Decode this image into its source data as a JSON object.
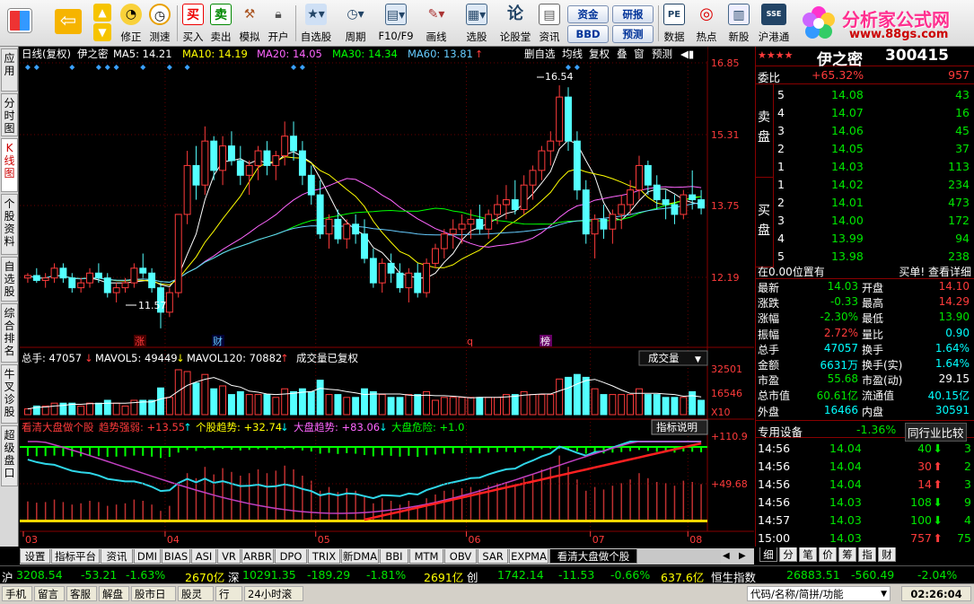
{
  "toolbar": {
    "buttons": [
      "修正",
      "测速",
      "买入",
      "卖出",
      "模拟",
      "开户",
      "自选股",
      "周期",
      "F10/F9",
      "画线",
      "选股",
      "论股堂",
      "资讯",
      "数据",
      "热点",
      "新股",
      "沪港通"
    ],
    "pills": [
      "资金",
      "研报",
      "BBD",
      "预测"
    ],
    "logo_title": "分析家公式网",
    "logo_url": "www.88gs.com"
  },
  "left_tabs": [
    "应用",
    "分时图",
    "K线图",
    "个股资料",
    "自选股",
    "综合排名",
    "牛叉诊股",
    "超级盘口"
  ],
  "chart_header": {
    "period": "日线(复权)",
    "stock": "伊之密",
    "ma5": "MA5: 14.21",
    "ma10": "MA10: 14.19",
    "ma20": "MA20: 14.05",
    "ma30": "MA30: 14.34",
    "ma60": "MA60: 13.81",
    "buttons": [
      "删自选",
      "均线",
      "复权",
      "叠",
      "窗",
      "预测"
    ]
  },
  "price_axis": [
    "16.85",
    "15.31",
    "13.75",
    "12.19"
  ],
  "price_marks": {
    "high": "16.54",
    "low": "11.57"
  },
  "event_marks": [
    "涨",
    "财",
    "q",
    "榜"
  ],
  "volume_header": {
    "total": "总手: 47057",
    "mavol5": "MAVOL5: 49449",
    "mavol120": "MAVOL120: 70882",
    "note": "成交量已复权",
    "select": "成交量"
  },
  "volume_axis": [
    "32501",
    "16546",
    "X10"
  ],
  "indicator_header": {
    "name": "看清大盘做个股",
    "strong": "趋势强弱: +13.55",
    "stock": "个股趋势: +32.74",
    "market": "大盘趋势: +83.06",
    "danger": "大盘危险: +1.0",
    "help": "指标说明"
  },
  "indicator_axis": [
    "+110.9",
    "+49.68"
  ],
  "x_axis": [
    "03",
    "04",
    "05",
    "06",
    "07",
    "08"
  ],
  "quote": {
    "stars": "★★★★",
    "name": "伊之密",
    "code": "300415",
    "weibi_label": "委比",
    "weibi_val": "+65.32%",
    "weibi_diff": "957",
    "sell_label": "卖盘",
    "buy_label": "买盘",
    "asks": [
      [
        "5",
        "14.08",
        "43"
      ],
      [
        "4",
        "14.07",
        "16"
      ],
      [
        "3",
        "14.06",
        "45"
      ],
      [
        "2",
        "14.05",
        "37"
      ],
      [
        "1",
        "14.03",
        "113"
      ]
    ],
    "bids": [
      [
        "1",
        "14.02",
        "234"
      ],
      [
        "2",
        "14.01",
        "473"
      ],
      [
        "3",
        "14.00",
        "172"
      ],
      [
        "4",
        "13.99",
        "94"
      ],
      [
        "5",
        "13.98",
        "238"
      ]
    ],
    "position": "在0.00位置有",
    "detail": "买单! 查看详细",
    "stats": [
      [
        "最新",
        "14.03",
        "开盘",
        "14.10"
      ],
      [
        "涨跌",
        "-0.33",
        "最高",
        "14.29"
      ],
      [
        "涨幅",
        "-2.30%",
        "最低",
        "13.90"
      ],
      [
        "振幅",
        "2.72%",
        "量比",
        "0.90"
      ],
      [
        "总手",
        "47057",
        "换手",
        "1.64%"
      ],
      [
        "金额",
        "6631万",
        "换手(实)",
        "1.64%"
      ],
      [
        "市盈",
        "55.68",
        "市盈(动)",
        "29.15"
      ],
      [
        "总市值",
        "60.61亿",
        "流通值",
        "40.15亿"
      ],
      [
        "外盘",
        "16466",
        "内盘",
        "30591"
      ]
    ],
    "device": "专用设备",
    "device_chg": "-1.36%",
    "compare": "同行业比较",
    "ticks": [
      [
        "14:56",
        "14.04",
        "40",
        "3"
      ],
      [
        "14:56",
        "14.04",
        "30",
        "2"
      ],
      [
        "14:56",
        "14.04",
        "14",
        "3"
      ],
      [
        "14:56",
        "14.03",
        "108",
        "9"
      ],
      [
        "14:57",
        "14.03",
        "100",
        "4"
      ],
      [
        "15:00",
        "14.03",
        "757",
        "75"
      ]
    ],
    "tabs": [
      "细",
      "分",
      "笔",
      "价",
      "筹",
      "指",
      "财"
    ]
  },
  "bottom_tabs": [
    "设置",
    "指标平台",
    "资讯",
    "DMI",
    "BIAS",
    "ASI",
    "VR",
    "ARBR",
    "DPO",
    "TRIX",
    "新DMA",
    "BBI",
    "MTM",
    "OBV",
    "SAR",
    "EXPMA",
    "看清大盘做个股"
  ],
  "index_bar": {
    "sh_label": "沪",
    "sh": "3208.54",
    "sh_chg": "-53.21",
    "sh_pct": "-1.63%",
    "sh_amt": "2670亿",
    "sz_label": "深",
    "sz": "10291.35",
    "sz_chg": "-189.29",
    "sz_pct": "-1.81%",
    "sz_amt": "2691亿",
    "cy_label": "创",
    "cy": "1742.14",
    "cy_chg": "-11.53",
    "cy_pct": "-0.66%",
    "cy_amt": "637.6亿",
    "hs_label": "恒生指数",
    "hs": "26883.51",
    "hs_chg": "-560.49",
    "hs_pct": "-2.04%"
  },
  "status_bar": {
    "items": [
      "手机",
      "留言",
      "客服",
      "解盘",
      "股市日记",
      "股灵通",
      "行情",
      "24小时滚动"
    ],
    "search": "代码/名称/简拼/功能",
    "time": "02:26:04"
  },
  "chart_data": {
    "type": "candlestick",
    "title": "伊之密 日线(复权)",
    "ylim": [
      11.2,
      17.0
    ],
    "x_ticks": [
      "03",
      "04",
      "05",
      "06",
      "07",
      "08"
    ],
    "candles_ohlc": [
      [
        12.6,
        12.7,
        12.5,
        12.65
      ],
      [
        12.65,
        12.8,
        12.5,
        12.55
      ],
      [
        12.55,
        12.7,
        12.4,
        12.6
      ],
      [
        12.6,
        12.9,
        12.5,
        12.8
      ],
      [
        12.8,
        12.9,
        12.5,
        12.6
      ],
      [
        12.6,
        12.7,
        12.3,
        12.4
      ],
      [
        12.4,
        12.6,
        12.3,
        12.5
      ],
      [
        12.5,
        12.8,
        12.4,
        12.7
      ],
      [
        12.7,
        12.9,
        12.5,
        12.6
      ],
      [
        12.6,
        12.7,
        12.2,
        12.3
      ],
      [
        12.3,
        12.5,
        12.1,
        12.4
      ],
      [
        12.4,
        12.6,
        12.3,
        12.5
      ],
      [
        12.5,
        12.9,
        12.4,
        12.8
      ],
      [
        12.8,
        13.1,
        12.6,
        12.7
      ],
      [
        12.7,
        12.8,
        12.3,
        12.4
      ],
      [
        12.4,
        12.5,
        11.57,
        11.9
      ],
      [
        11.9,
        12.4,
        11.8,
        12.3
      ],
      [
        12.3,
        13.9,
        12.2,
        13.9
      ],
      [
        13.9,
        15.2,
        13.7,
        14.9
      ],
      [
        14.9,
        15.3,
        14.2,
        14.5
      ],
      [
        14.5,
        15.7,
        14.3,
        15.4
      ],
      [
        15.4,
        15.5,
        14.6,
        14.8
      ],
      [
        14.8,
        15.5,
        14.5,
        15.3
      ],
      [
        15.3,
        15.6,
        14.9,
        15.0
      ],
      [
        15.0,
        15.3,
        14.5,
        14.7
      ],
      [
        14.7,
        15.0,
        14.3,
        14.9
      ],
      [
        14.9,
        15.3,
        14.6,
        15.2
      ],
      [
        15.2,
        15.4,
        14.7,
        14.9
      ],
      [
        14.9,
        15.2,
        14.6,
        15.1
      ],
      [
        15.1,
        15.8,
        14.9,
        15.5
      ],
      [
        15.5,
        15.8,
        15.0,
        15.2
      ],
      [
        15.2,
        15.4,
        14.5,
        14.7
      ],
      [
        14.7,
        14.9,
        14.1,
        14.3
      ],
      [
        14.3,
        14.6,
        13.4,
        13.5
      ],
      [
        13.5,
        13.9,
        13.2,
        13.8
      ],
      [
        13.8,
        14.0,
        13.3,
        13.4
      ],
      [
        13.4,
        13.8,
        13.2,
        13.7
      ],
      [
        13.7,
        13.9,
        13.3,
        13.5
      ],
      [
        13.5,
        13.8,
        12.9,
        13.0
      ],
      [
        13.0,
        13.2,
        12.4,
        12.5
      ],
      [
        12.5,
        13.0,
        12.3,
        12.9
      ],
      [
        12.9,
        13.1,
        12.5,
        12.7
      ],
      [
        12.7,
        12.9,
        12.3,
        12.4
      ],
      [
        12.4,
        12.8,
        12.1,
        12.7
      ],
      [
        12.7,
        12.9,
        12.2,
        12.3
      ],
      [
        12.3,
        13.0,
        12.2,
        12.9
      ],
      [
        12.9,
        13.3,
        12.8,
        13.2
      ],
      [
        13.2,
        13.6,
        13.0,
        13.5
      ],
      [
        13.5,
        13.8,
        13.2,
        13.6
      ],
      [
        13.6,
        13.9,
        13.3,
        13.7
      ],
      [
        13.7,
        14.0,
        13.4,
        13.8
      ],
      [
        13.8,
        14.1,
        13.5,
        13.6
      ],
      [
        13.6,
        14.0,
        13.4,
        13.9
      ],
      [
        13.9,
        14.3,
        13.7,
        14.1
      ],
      [
        14.1,
        14.5,
        13.8,
        14.2
      ],
      [
        14.2,
        14.6,
        13.9,
        14.0
      ],
      [
        14.0,
        14.7,
        13.9,
        14.5
      ],
      [
        14.5,
        14.9,
        14.2,
        14.8
      ],
      [
        14.8,
        15.3,
        14.6,
        15.2
      ],
      [
        15.2,
        15.6,
        14.9,
        15.4
      ],
      [
        15.4,
        16.54,
        15.3,
        16.3
      ],
      [
        16.3,
        16.5,
        15.2,
        15.4
      ],
      [
        15.4,
        15.6,
        14.2,
        14.4
      ],
      [
        14.4,
        14.6,
        13.3,
        13.5
      ],
      [
        13.5,
        13.9,
        13.0,
        13.8
      ],
      [
        13.8,
        14.1,
        13.4,
        13.6
      ],
      [
        13.6,
        14.0,
        13.3,
        13.9
      ],
      [
        13.9,
        14.3,
        13.6,
        14.1
      ],
      [
        14.1,
        14.6,
        13.9,
        14.4
      ],
      [
        14.4,
        15.1,
        14.2,
        14.9
      ],
      [
        14.9,
        15.0,
        14.3,
        14.5
      ],
      [
        14.5,
        14.7,
        14.0,
        14.2
      ],
      [
        14.2,
        14.4,
        13.8,
        14.1
      ],
      [
        14.1,
        14.3,
        13.7,
        13.9
      ],
      [
        13.9,
        14.4,
        13.8,
        14.3
      ],
      [
        14.3,
        14.8,
        14.0,
        14.2
      ],
      [
        14.2,
        14.4,
        13.9,
        14.03
      ]
    ],
    "series": [
      {
        "name": "MA5",
        "value": 14.21
      },
      {
        "name": "MA10",
        "value": 14.19
      },
      {
        "name": "MA20",
        "value": 14.05
      },
      {
        "name": "MA30",
        "value": 14.34
      },
      {
        "name": "MA60",
        "value": 13.81
      }
    ]
  }
}
